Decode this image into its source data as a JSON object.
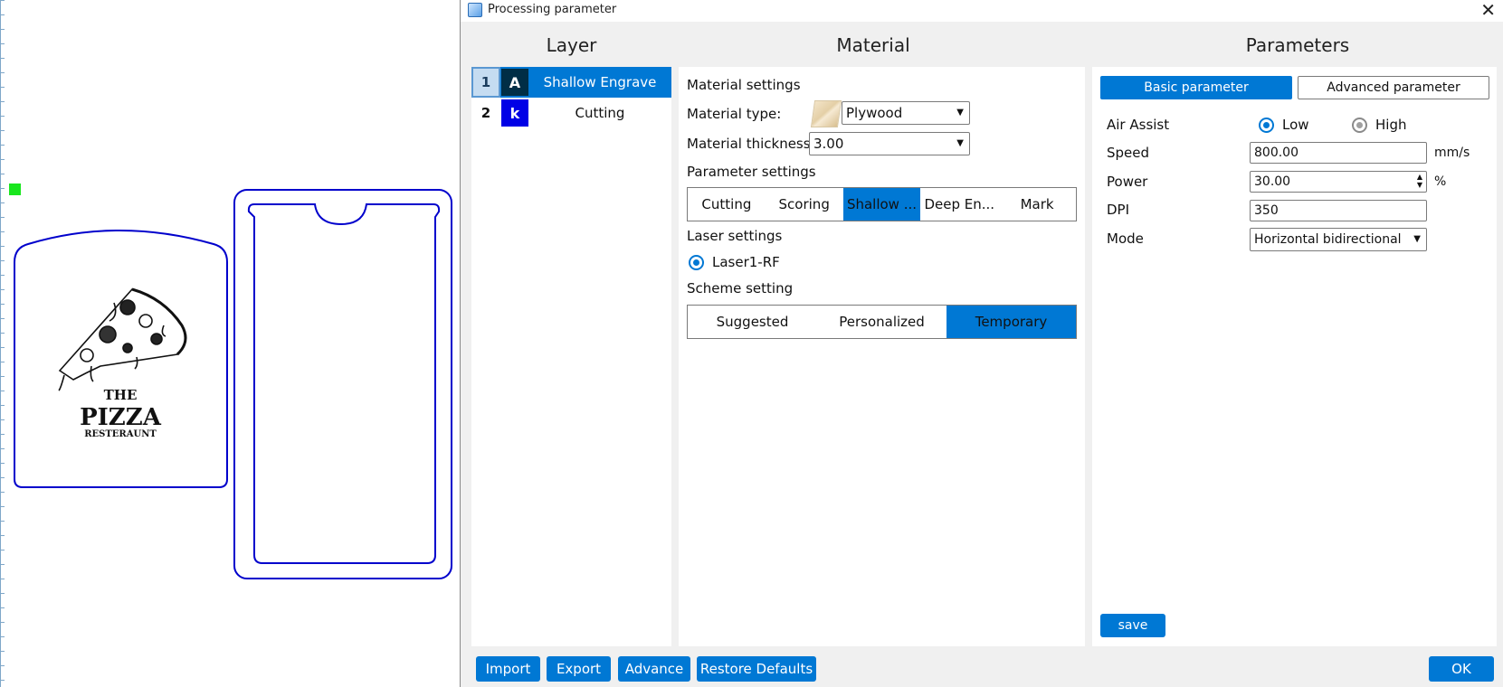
{
  "dialog": {
    "title": "Processing parameter"
  },
  "headings": {
    "layer": "Layer",
    "material": "Material",
    "parameters": "Parameters"
  },
  "layers": [
    {
      "number": "1",
      "swatch_letter": "A",
      "swatch_color": "#002e46",
      "name": "Shallow Engrave",
      "selected": true
    },
    {
      "number": "2",
      "swatch_letter": "k",
      "swatch_color": "#0000e6",
      "name": "Cutting",
      "selected": false
    }
  ],
  "material": {
    "settings_label": "Material settings",
    "type_label": "Material type:",
    "type_value": "Plywood",
    "thickness_label": "Material thickness:",
    "thickness_value": "3.00",
    "parameter_settings_label": "Parameter settings",
    "process_tabs": [
      "Cutting",
      "Scoring",
      "Shallow ...",
      "Deep En...",
      "Mark"
    ],
    "laser_settings_label": "Laser settings",
    "laser_option": "Laser1-RF",
    "scheme_label": "Scheme setting",
    "scheme_tabs": [
      "Suggested",
      "Personalized",
      "Temporary"
    ]
  },
  "parameters": {
    "tab_basic": "Basic parameter",
    "tab_advanced": "Advanced parameter",
    "air_assist_label": "Air Assist",
    "air_low": "Low",
    "air_high": "High",
    "speed_label": "Speed",
    "speed_value": "800.00",
    "speed_unit": "mm/s",
    "power_label": "Power",
    "power_value": "30.00",
    "power_unit": "%",
    "dpi_label": "DPI",
    "dpi_value": "350",
    "mode_label": "Mode",
    "mode_value": "Horizontal bidirectional",
    "save_label": "save"
  },
  "footer": {
    "import_label": "Import",
    "export_label": "Export",
    "advance_label": "Advance",
    "restore_label": "Restore Defaults",
    "ok_label": "OK"
  },
  "canvas": {
    "logo_the": "THE",
    "logo_pizza": "PIZZA",
    "logo_restaurant": "RESTERAUNT",
    "outline_color": "#0000cc",
    "marker_color": "#19e61e"
  },
  "colors": {
    "accent": "#0078d4"
  }
}
